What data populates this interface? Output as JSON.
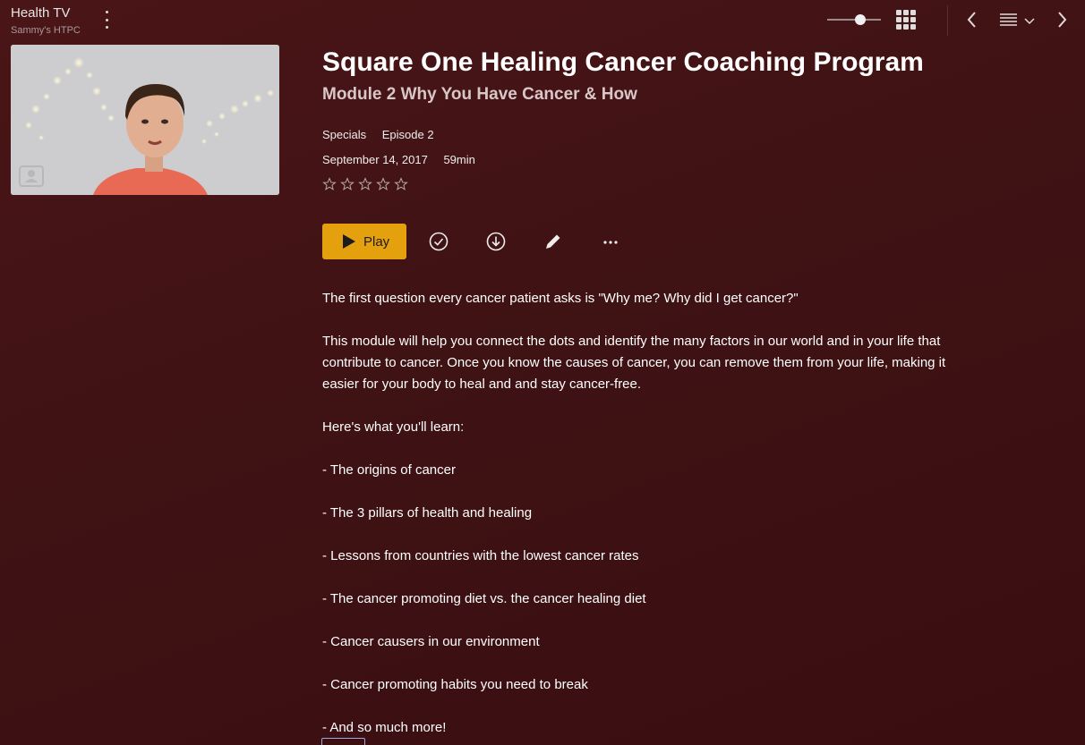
{
  "header": {
    "library_title": "Health TV",
    "server_name": "Sammy's HTPC",
    "icons": [
      "more-vertical-icon",
      "zoom-slider",
      "grid-view-icon",
      "back-arrow-icon",
      "list-view-icon",
      "chevron-down-icon",
      "forward-arrow-icon"
    ]
  },
  "episode": {
    "title": "Square One Healing Cancer Coaching Program",
    "subtitle": "Module 2 Why You Have Cancer & How",
    "season": "Specials",
    "episode_number": "Episode 2",
    "air_date": "September 14, 2017",
    "duration": "59min",
    "rating_stars_filled": 0,
    "rating_stars_total": 5
  },
  "actions": {
    "play_label": "Play",
    "icons": [
      "play-icon",
      "mark-watched-icon",
      "download-icon",
      "edit-icon",
      "more-horizontal-icon"
    ]
  },
  "summary": {
    "paragraphs": [
      "The first question every cancer patient asks is \"Why me? Why did I get cancer?\"",
      "This module will help you connect the dots and identify the many factors in our world and in your life that contribute to cancer. Once you know the causes of cancer, you can remove them from your life, making it easier for your body to heal and and stay cancer-free.",
      "Here's what you'll learn:",
      "- The origins of cancer",
      "- The 3 pillars of health and healing",
      "- Lessons from countries with the lowest cancer rates",
      "- The cancer promoting diet vs. the cancer healing diet",
      "- Cancer causers in our environment",
      "- Cancer promoting habits you need to break",
      "- And so much more!"
    ]
  },
  "colors": {
    "background": "#441316",
    "accent": "#e5a00d",
    "text": "#ffffff",
    "subtitle": "#d9c7c7"
  }
}
